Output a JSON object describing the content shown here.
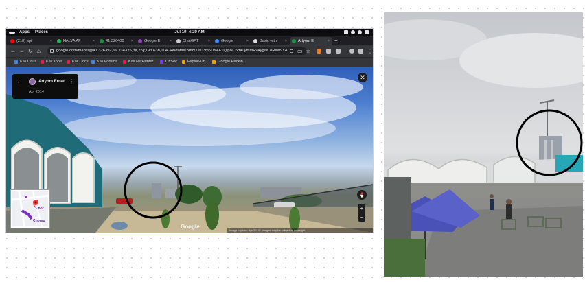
{
  "os_bar": {
    "apps_label": "Apps",
    "places_label": "Places",
    "date": "Jul 19",
    "time": "4:20 AM"
  },
  "tabs": [
    {
      "label": "(218) api",
      "favicon_color": "#ff0000"
    },
    {
      "label": "HALVA AF",
      "favicon_color": "#1db954"
    },
    {
      "label": "41.326400",
      "favicon_color": "#1e8e3e"
    },
    {
      "label": "Google E",
      "favicon_color": "#8e44ad"
    },
    {
      "label": "ChatGPT",
      "favicon_color": "#d0d0d0"
    },
    {
      "label": "Google",
      "favicon_color": "#4285f4"
    },
    {
      "label": "Basic with",
      "favicon_color": "#e0e0e0"
    },
    {
      "label": "Artyom E",
      "favicon_color": "#1e8e3e"
    }
  ],
  "new_tab_label": "+",
  "address_bar": {
    "url": "google.com/maps/@41.326392,69.234325,3a,75y,193.63h,104.34t/data=!3m8!1e1!3m6!1sAF1QipNC5d40ymmRv4ygaK7iRaw9Y4...",
    "extension_colors": [
      "#e67e22",
      "#c0c0c0",
      "#c0c0c0",
      "#c0c0c0",
      "#c0c0c0"
    ]
  },
  "bookmarks": [
    {
      "label": "Kali Linux",
      "icon_color": "#3b82f6"
    },
    {
      "label": "Kali Tools",
      "icon_color": "#e11d48"
    },
    {
      "label": "Kali Docs",
      "icon_color": "#e11d48"
    },
    {
      "label": "Kali Forums",
      "icon_color": "#3b82f6"
    },
    {
      "label": "Kali NetHunter",
      "icon_color": "#e11d48"
    },
    {
      "label": "OffSec",
      "icon_color": "#7c3aed"
    },
    {
      "label": "Exploit-DB",
      "icon_color": "#f59e0b"
    },
    {
      "label": "Google Hackin...",
      "icon_color": "#f59e0b"
    }
  ],
  "street_view": {
    "contributor_name": "Artyom Ernat",
    "capture_date": "Apr 2014",
    "watermark": "Google",
    "image_credit": "Image capture: Apr 2014 · Images may be subject to copyright.",
    "mini_map_labels": [
      "Chor",
      "Chorsu"
    ],
    "zoom_in_label": "+",
    "zoom_out_label": "−",
    "close_label": "✕"
  },
  "colors": {
    "browser_dark": "#202124",
    "toolbar": "#35363a",
    "annotation_circle": "#000000",
    "map_route": "#7b2fbe"
  }
}
